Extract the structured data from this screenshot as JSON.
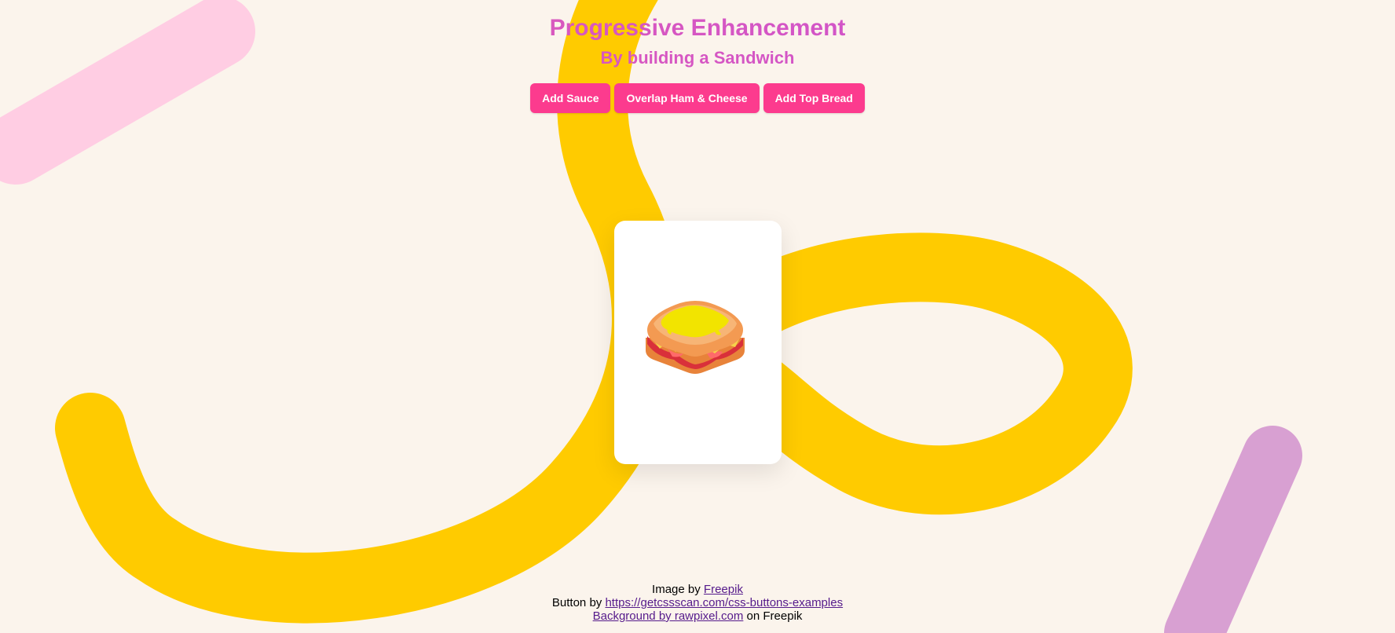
{
  "header": {
    "title": "Progressive Enhancement",
    "subtitle": "By building a Sandwich"
  },
  "controls": {
    "add_sauce": "Add Sauce",
    "overlap": "Overlap Ham & Cheese",
    "add_top_bread": "Add Top Bread"
  },
  "credits": {
    "line1_prefix": "Image by ",
    "line1_link": "Freepik",
    "line2_prefix": "Button by ",
    "line2_link": "https://getcssscan.com/css-buttons-examples",
    "line3_link": "Background by rawpixel.com",
    "line3_suffix": " on Freepik"
  },
  "colors": {
    "background": "#fbf4ec",
    "button": "#fc3b8e",
    "title_gradient_start": "#e45db0",
    "title_gradient_end": "#c74fd6",
    "yellow_squiggle": "#ffcb00",
    "pink_stroke": "#ffcde3",
    "purple_stroke": "#d8a0d2"
  },
  "icons": {
    "sandwich": "sandwich-icon"
  }
}
